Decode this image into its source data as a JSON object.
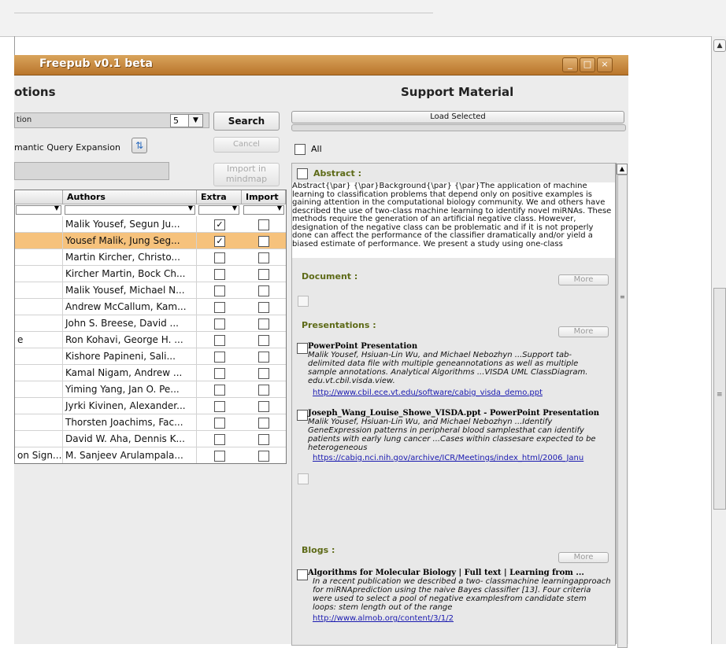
{
  "window": {
    "title": "Freepub v0.1 beta",
    "controls": {
      "minimize": "_",
      "maximize": "□",
      "close": "×"
    }
  },
  "left": {
    "header": "otions",
    "search_value": "tion",
    "result_count": "5",
    "search_button": "Search",
    "cancel_button": "Cancel",
    "query_expansion_label": "mantic Query Expansion",
    "import_mindmap_button": "Import in mindmap",
    "table": {
      "headers": {
        "authors": "Authors",
        "extra": "Extra",
        "import": "Import"
      },
      "rows": [
        {
          "title": "",
          "authors": "Malik Yousef, Segun Ju...",
          "extra": true,
          "import": false,
          "selected": false
        },
        {
          "title": "",
          "authors": "Yousef Malik, Jung Seg...",
          "extra": true,
          "import": false,
          "selected": true
        },
        {
          "title": "",
          "authors": "Martin Kircher, Christo...",
          "extra": false,
          "import": false,
          "selected": false
        },
        {
          "title": "",
          "authors": "Kircher Martin, Bock Ch...",
          "extra": false,
          "import": false,
          "selected": false
        },
        {
          "title": "",
          "authors": "Malik Yousef, Michael N...",
          "extra": false,
          "import": false,
          "selected": false
        },
        {
          "title": "",
          "authors": "Andrew McCallum, Kam...",
          "extra": false,
          "import": false,
          "selected": false
        },
        {
          "title": "",
          "authors": "John S. Breese, David ...",
          "extra": false,
          "import": false,
          "selected": false
        },
        {
          "title": "e",
          "authors": "Ron Kohavi, George H. ...",
          "extra": false,
          "import": false,
          "selected": false
        },
        {
          "title": "",
          "authors": "Kishore Papineni, Sali...",
          "extra": false,
          "import": false,
          "selected": false
        },
        {
          "title": "",
          "authors": "Kamal Nigam, Andrew ...",
          "extra": false,
          "import": false,
          "selected": false
        },
        {
          "title": "",
          "authors": "Yiming Yang, Jan O. Pe...",
          "extra": false,
          "import": false,
          "selected": false
        },
        {
          "title": "",
          "authors": "Jyrki Kivinen, Alexander...",
          "extra": false,
          "import": false,
          "selected": false
        },
        {
          "title": "",
          "authors": "Thorsten Joachims, Fac...",
          "extra": false,
          "import": false,
          "selected": false
        },
        {
          "title": "",
          "authors": "David W. Aha, Dennis K...",
          "extra": false,
          "import": false,
          "selected": false
        },
        {
          "title": "on Sign...",
          "authors": "M. Sanjeev Arulampala...",
          "extra": false,
          "import": false,
          "selected": false
        }
      ]
    }
  },
  "right": {
    "header": "Support Material",
    "load_selected_button": "Load Selected",
    "all_label": "All",
    "abstract_label": "Abstract :",
    "abstract_text": "Abstract{\\par} {\\par}Background{\\par} {\\par}The application of machine learning to classification problems that depend only on positive examples is gaining attention in the computational biology community. We and others have described the use of two-class machine learning to identify novel miRNAs. These methods require the generation of an artificial negative class. However, designation of the negative class can be problematic and if it is not properly done can affect the performance of the classifier dramatically and/or yield a biased estimate of performance. We present a study using one-class",
    "document_label": "Document :",
    "presentations_label": "Presentations :",
    "blogs_label": "Blogs :",
    "more_label": "More",
    "presentations": [
      {
        "title": "PowerPoint Presentation",
        "desc": "Malik Yousef, Hsiuan-Lin Wu, and Michael Nebozhyn ...Support tab-delimited data file with multiple geneannotations as well as multiple sample annotations. Analytical Algorithms ...VISDA UML ClassDiagram. edu.vt.cbil.visda.view.",
        "link": "http://www.cbil.ece.vt.edu/software/cabig_visda_demo.ppt"
      },
      {
        "title": "Joseph_Wang_Louise_Showe_VISDA.ppt - PowerPoint Presentation",
        "desc": "Malik Yousef, Hsiuan-Lin Wu, and Michael Nebozhyn ...Identify GeneExpression patterns in peripheral blood samplesthat can identify patients with early lung cancer ...Cases within classesare expected to be heterogeneous",
        "link": "https://cabig.nci.nih.gov/archive/ICR/Meetings/index_html/2006_Janu"
      }
    ],
    "blogs": [
      {
        "title": "Algorithms for Molecular Biology | Full text | Learning from ...",
        "desc": "In a recent publication we described a two- classmachine learningapproach for miRNAprediction using the naive Bayes classifier [13]. Four criteria were used to select a pool of negative examplesfrom candidate stem loops: stem length out of the range",
        "link": "http://www.almob.org/content/3/1/2"
      }
    ]
  },
  "colors": {
    "titlebar": "#c48638",
    "selected_row": "#f6c27c",
    "section_label": "#5d6a17",
    "link": "#1a1ab0"
  },
  "icons": [
    "refresh-icon",
    "dropdown-arrow-icon",
    "scroll-up-icon",
    "grip-icon"
  ]
}
